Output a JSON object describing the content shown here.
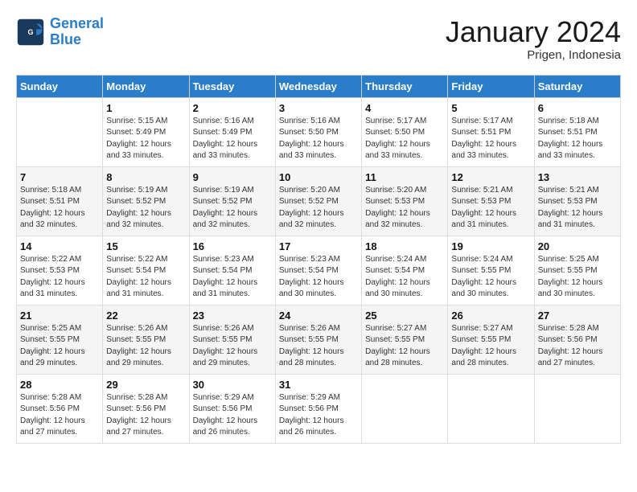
{
  "header": {
    "logo_line1": "General",
    "logo_line2": "Blue",
    "title": "January 2024",
    "subtitle": "Prigen, Indonesia"
  },
  "weekdays": [
    "Sunday",
    "Monday",
    "Tuesday",
    "Wednesday",
    "Thursday",
    "Friday",
    "Saturday"
  ],
  "weeks": [
    [
      {
        "day": "",
        "sunrise": "",
        "sunset": "",
        "daylight": ""
      },
      {
        "day": "1",
        "sunrise": "5:15 AM",
        "sunset": "5:49 PM",
        "daylight": "12 hours and 33 minutes."
      },
      {
        "day": "2",
        "sunrise": "5:16 AM",
        "sunset": "5:49 PM",
        "daylight": "12 hours and 33 minutes."
      },
      {
        "day": "3",
        "sunrise": "5:16 AM",
        "sunset": "5:50 PM",
        "daylight": "12 hours and 33 minutes."
      },
      {
        "day": "4",
        "sunrise": "5:17 AM",
        "sunset": "5:50 PM",
        "daylight": "12 hours and 33 minutes."
      },
      {
        "day": "5",
        "sunrise": "5:17 AM",
        "sunset": "5:51 PM",
        "daylight": "12 hours and 33 minutes."
      },
      {
        "day": "6",
        "sunrise": "5:18 AM",
        "sunset": "5:51 PM",
        "daylight": "12 hours and 33 minutes."
      }
    ],
    [
      {
        "day": "7",
        "sunrise": "5:18 AM",
        "sunset": "5:51 PM",
        "daylight": "12 hours and 32 minutes."
      },
      {
        "day": "8",
        "sunrise": "5:19 AM",
        "sunset": "5:52 PM",
        "daylight": "12 hours and 32 minutes."
      },
      {
        "day": "9",
        "sunrise": "5:19 AM",
        "sunset": "5:52 PM",
        "daylight": "12 hours and 32 minutes."
      },
      {
        "day": "10",
        "sunrise": "5:20 AM",
        "sunset": "5:52 PM",
        "daylight": "12 hours and 32 minutes."
      },
      {
        "day": "11",
        "sunrise": "5:20 AM",
        "sunset": "5:53 PM",
        "daylight": "12 hours and 32 minutes."
      },
      {
        "day": "12",
        "sunrise": "5:21 AM",
        "sunset": "5:53 PM",
        "daylight": "12 hours and 31 minutes."
      },
      {
        "day": "13",
        "sunrise": "5:21 AM",
        "sunset": "5:53 PM",
        "daylight": "12 hours and 31 minutes."
      }
    ],
    [
      {
        "day": "14",
        "sunrise": "5:22 AM",
        "sunset": "5:53 PM",
        "daylight": "12 hours and 31 minutes."
      },
      {
        "day": "15",
        "sunrise": "5:22 AM",
        "sunset": "5:54 PM",
        "daylight": "12 hours and 31 minutes."
      },
      {
        "day": "16",
        "sunrise": "5:23 AM",
        "sunset": "5:54 PM",
        "daylight": "12 hours and 31 minutes."
      },
      {
        "day": "17",
        "sunrise": "5:23 AM",
        "sunset": "5:54 PM",
        "daylight": "12 hours and 30 minutes."
      },
      {
        "day": "18",
        "sunrise": "5:24 AM",
        "sunset": "5:54 PM",
        "daylight": "12 hours and 30 minutes."
      },
      {
        "day": "19",
        "sunrise": "5:24 AM",
        "sunset": "5:55 PM",
        "daylight": "12 hours and 30 minutes."
      },
      {
        "day": "20",
        "sunrise": "5:25 AM",
        "sunset": "5:55 PM",
        "daylight": "12 hours and 30 minutes."
      }
    ],
    [
      {
        "day": "21",
        "sunrise": "5:25 AM",
        "sunset": "5:55 PM",
        "daylight": "12 hours and 29 minutes."
      },
      {
        "day": "22",
        "sunrise": "5:26 AM",
        "sunset": "5:55 PM",
        "daylight": "12 hours and 29 minutes."
      },
      {
        "day": "23",
        "sunrise": "5:26 AM",
        "sunset": "5:55 PM",
        "daylight": "12 hours and 29 minutes."
      },
      {
        "day": "24",
        "sunrise": "5:26 AM",
        "sunset": "5:55 PM",
        "daylight": "12 hours and 28 minutes."
      },
      {
        "day": "25",
        "sunrise": "5:27 AM",
        "sunset": "5:55 PM",
        "daylight": "12 hours and 28 minutes."
      },
      {
        "day": "26",
        "sunrise": "5:27 AM",
        "sunset": "5:55 PM",
        "daylight": "12 hours and 28 minutes."
      },
      {
        "day": "27",
        "sunrise": "5:28 AM",
        "sunset": "5:56 PM",
        "daylight": "12 hours and 27 minutes."
      }
    ],
    [
      {
        "day": "28",
        "sunrise": "5:28 AM",
        "sunset": "5:56 PM",
        "daylight": "12 hours and 27 minutes."
      },
      {
        "day": "29",
        "sunrise": "5:28 AM",
        "sunset": "5:56 PM",
        "daylight": "12 hours and 27 minutes."
      },
      {
        "day": "30",
        "sunrise": "5:29 AM",
        "sunset": "5:56 PM",
        "daylight": "12 hours and 26 minutes."
      },
      {
        "day": "31",
        "sunrise": "5:29 AM",
        "sunset": "5:56 PM",
        "daylight": "12 hours and 26 minutes."
      },
      {
        "day": "",
        "sunrise": "",
        "sunset": "",
        "daylight": ""
      },
      {
        "day": "",
        "sunrise": "",
        "sunset": "",
        "daylight": ""
      },
      {
        "day": "",
        "sunrise": "",
        "sunset": "",
        "daylight": ""
      }
    ]
  ]
}
